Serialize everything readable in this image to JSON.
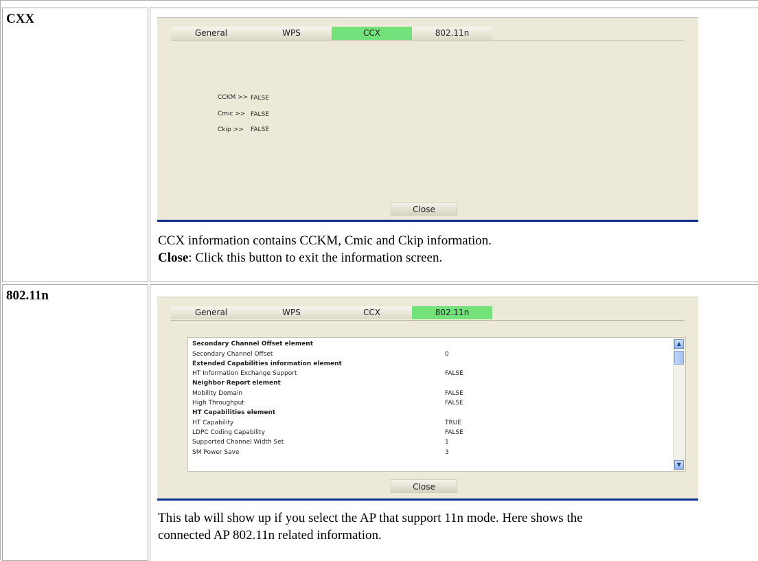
{
  "sections": [
    {
      "label": "CXX",
      "tabs": [
        "General",
        "WPS",
        "CCX",
        "802.11n"
      ],
      "active_tab": 2,
      "fields": [
        {
          "key": "CCKM >>",
          "value": "FALSE"
        },
        {
          "key": "Cmic >>",
          "value": "FALSE"
        },
        {
          "key": "Ckip >>",
          "value": "FALSE"
        }
      ],
      "close_label": "Close",
      "desc_line1": "CCX information contains CCKM, Cmic and Ckip information.",
      "desc_bold": "Close",
      "desc_line2_rest": ": Click this button to exit the information screen."
    },
    {
      "label": "802.11n",
      "tabs": [
        "General",
        "WPS",
        "CCX",
        "802.11n"
      ],
      "active_tab": 3,
      "rows": [
        {
          "name": "Secondary Channel Offset element",
          "value": "",
          "header": true
        },
        {
          "name": "Secondary Channel Offset",
          "value": "0",
          "header": false
        },
        {
          "name": "Extended Capabilities information element",
          "value": "",
          "header": true
        },
        {
          "name": "HT Information Exchange Support",
          "value": "FALSE",
          "header": false
        },
        {
          "name": "Neighbor Report element",
          "value": "",
          "header": true
        },
        {
          "name": "Mobility Domain",
          "value": "FALSE",
          "header": false
        },
        {
          "name": "High Throughput",
          "value": "FALSE",
          "header": false
        },
        {
          "name": "HT Capabilities element",
          "value": "",
          "header": true
        },
        {
          "name": "HT Capability",
          "value": "TRUE",
          "header": false
        },
        {
          "name": "LDPC Coding Capability",
          "value": "FALSE",
          "header": false
        },
        {
          "name": "Supported Channel Width Set",
          "value": "1",
          "header": false
        },
        {
          "name": "SM Power Save",
          "value": "3",
          "header": false
        }
      ],
      "close_label": "Close",
      "desc_line1": "This tab will show up if you select the AP that support 11n mode. Here shows the",
      "desc_line2": "connected AP 802.11n related information."
    }
  ]
}
